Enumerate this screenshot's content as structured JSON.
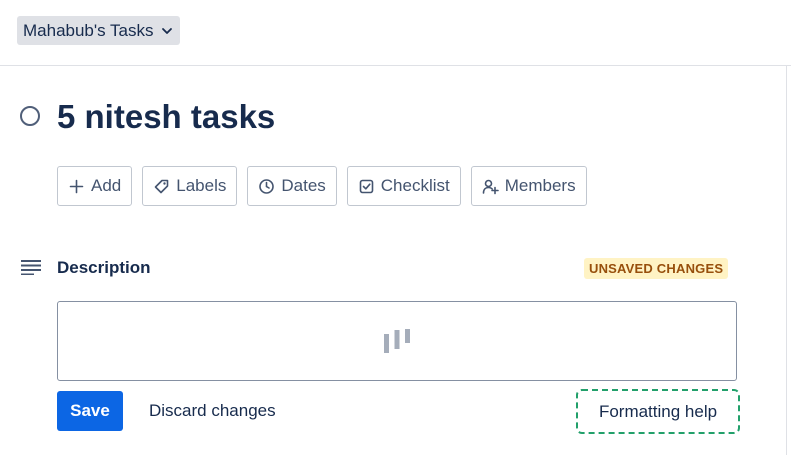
{
  "header": {
    "board_switcher_label": "Mahabub's Tasks"
  },
  "card": {
    "title": "5 nitesh tasks"
  },
  "actions": {
    "add": "Add",
    "labels": "Labels",
    "dates": "Dates",
    "checklist": "Checklist",
    "members": "Members"
  },
  "description": {
    "heading": "Description",
    "badge": "UNSAVED CHANGES",
    "save_label": "Save",
    "discard_label": "Discard changes",
    "formatting_help_label": "Formatting help"
  },
  "colors": {
    "primary_button": "#0c66e4",
    "unsaved_badge_bg": "#fff3c4",
    "unsaved_badge_text": "#974f0c",
    "focus_ring": "#22a06b"
  },
  "icons": {
    "board_switcher": "chevron-down-icon",
    "card_status": "radio-circle-icon",
    "add": "plus-icon",
    "labels": "tag-icon",
    "dates": "clock-icon",
    "checklist": "checkbox-icon",
    "members": "add-member-icon",
    "description": "description-lines-icon",
    "editor_loading": "loading-bars-icon"
  }
}
